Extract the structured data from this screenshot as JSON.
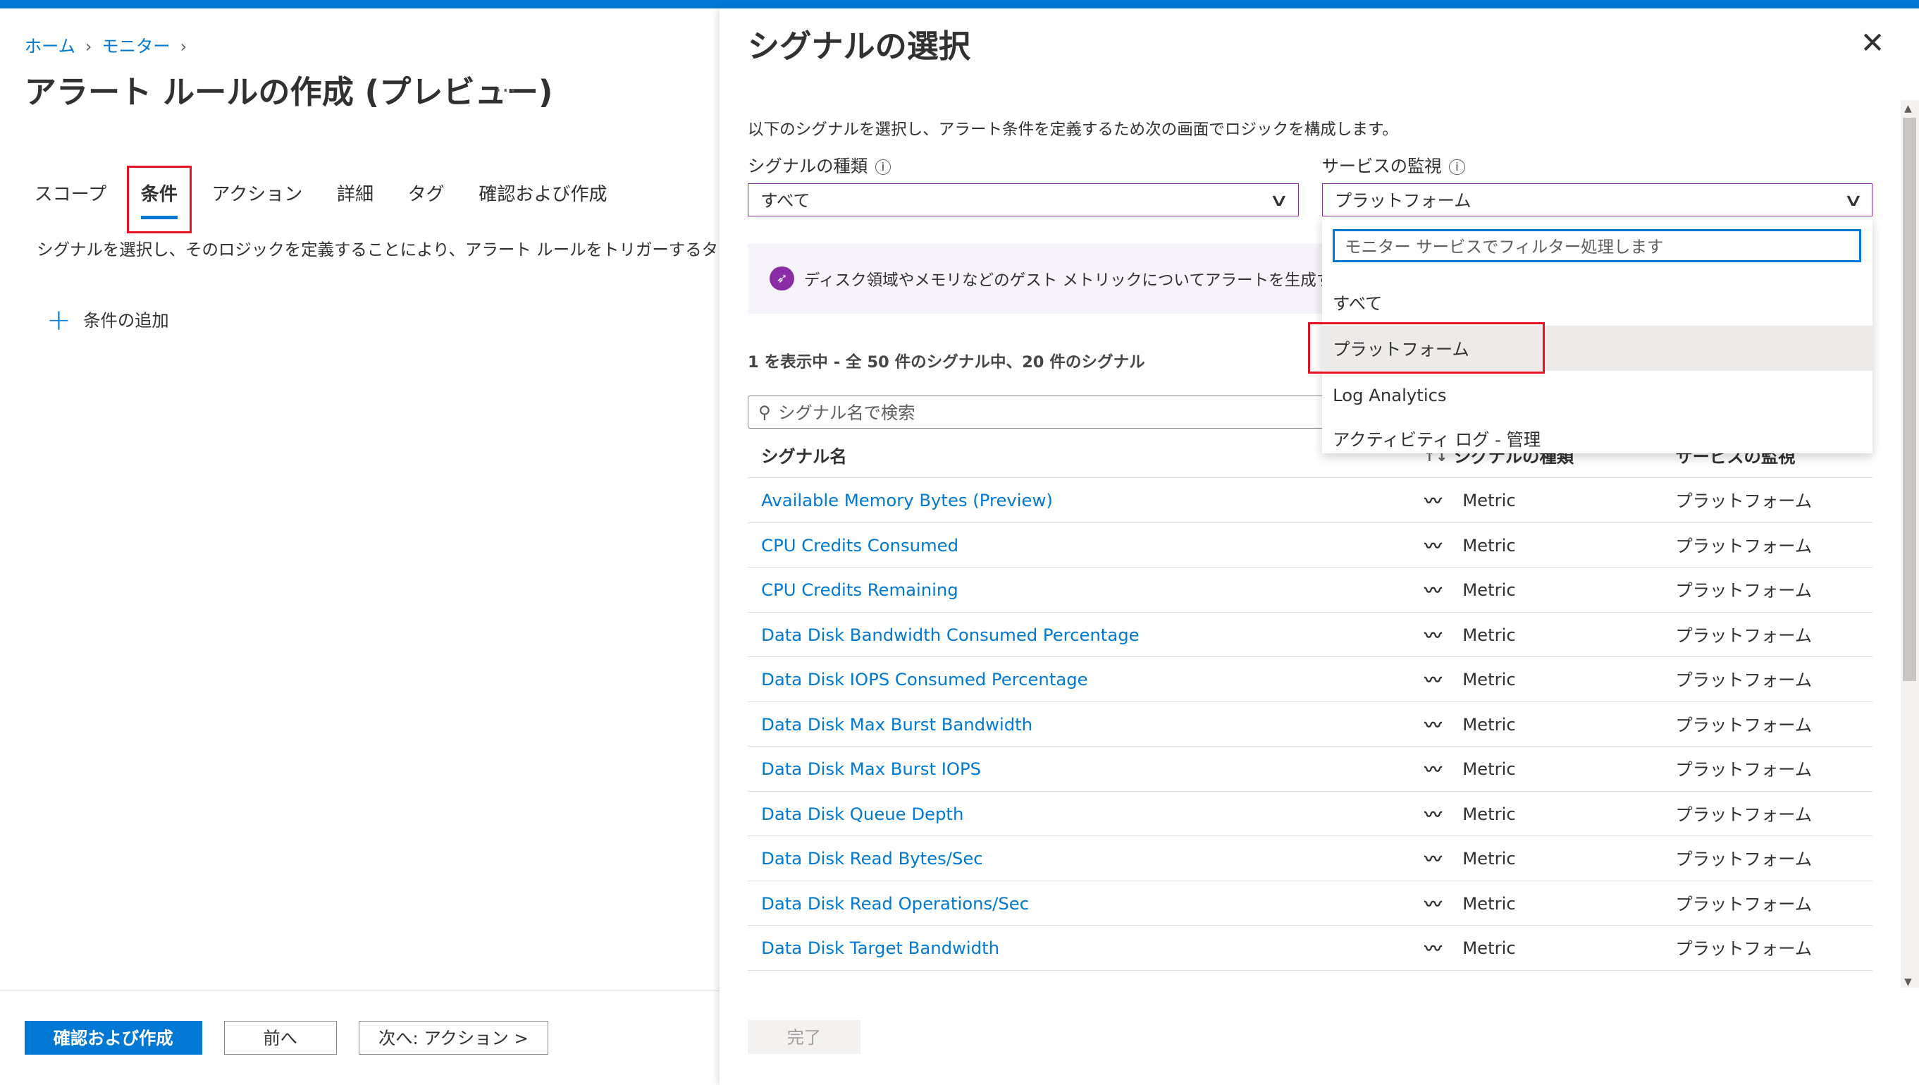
{
  "breadcrumb": [
    "ホーム",
    "モニター"
  ],
  "page_title": "アラート ルールの作成 (プレビュー)",
  "more": "…",
  "tabs": [
    "スコープ",
    "条件",
    "アクション",
    "詳細",
    "タグ",
    "確認および作成"
  ],
  "active_tab": "条件",
  "condition_desc": "シグナルを選択し、そのロジックを定義することにより、アラート ルールをトリガーするタイミングを構成します。",
  "add_condition": "条件の追加",
  "footer": {
    "review": "確認および作成",
    "prev": "前へ",
    "next": "次へ: アクション >"
  },
  "panel": {
    "title": "シグナルの選択",
    "close": "✕",
    "desc": "以下のシグナルを選択し、アラート条件を定義するため次の画面でロジックを構成します。",
    "signal_type_label": "シグナルの種類",
    "signal_type_value": "すべて",
    "service_label": "サービスの監視",
    "service_value": "プラットフォーム",
    "banner": "ディスク領域やメモリなどのゲスト メトリックについてアラートを生成するには、ゲスト",
    "count": "1 を表示中 - 全 50 件のシグナル中、20 件のシグナル",
    "search_placeholder": "シグナル名で検索",
    "columns": [
      "シグナル名",
      "シグナルの種類",
      "サービスの監視"
    ],
    "rows": [
      {
        "name": "Available Memory Bytes (Preview)",
        "type": "Metric",
        "service": "プラットフォーム"
      },
      {
        "name": "CPU Credits Consumed",
        "type": "Metric",
        "service": "プラットフォーム"
      },
      {
        "name": "CPU Credits Remaining",
        "type": "Metric",
        "service": "プラットフォーム"
      },
      {
        "name": "Data Disk Bandwidth Consumed Percentage",
        "type": "Metric",
        "service": "プラットフォーム"
      },
      {
        "name": "Data Disk IOPS Consumed Percentage",
        "type": "Metric",
        "service": "プラットフォーム"
      },
      {
        "name": "Data Disk Max Burst Bandwidth",
        "type": "Metric",
        "service": "プラットフォーム"
      },
      {
        "name": "Data Disk Max Burst IOPS",
        "type": "Metric",
        "service": "プラットフォーム"
      },
      {
        "name": "Data Disk Queue Depth",
        "type": "Metric",
        "service": "プラットフォーム"
      },
      {
        "name": "Data Disk Read Bytes/Sec",
        "type": "Metric",
        "service": "プラットフォーム"
      },
      {
        "name": "Data Disk Read Operations/Sec",
        "type": "Metric",
        "service": "プラットフォーム"
      },
      {
        "name": "Data Disk Target Bandwidth",
        "type": "Metric",
        "service": "プラットフォーム"
      }
    ],
    "done": "完了",
    "dropdown": {
      "filter_placeholder": "モニター サービスでフィルター処理します",
      "options": [
        "すべて",
        "プラットフォーム",
        "Log Analytics",
        "アクティビティ ログ - 管理"
      ],
      "selected": "プラットフォーム"
    }
  },
  "colors": {
    "accent": "#0078d4",
    "highlight": "#e81123",
    "dropdown_border": "#8a2da5"
  }
}
